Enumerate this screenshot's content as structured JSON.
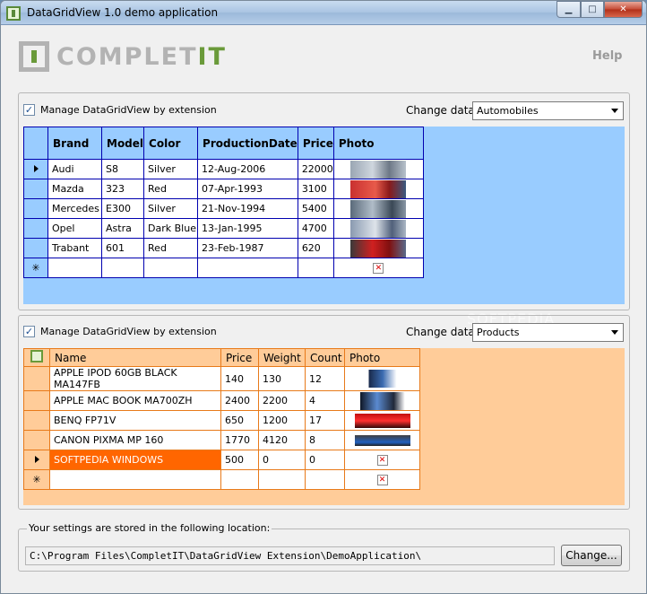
{
  "window": {
    "title": "DataGridView 1.0 demo application",
    "min_glyph": "▁",
    "max_glyph": "□",
    "close_glyph": "✕"
  },
  "header": {
    "logo_text_main": "COMPLET",
    "logo_text_accent": "IT",
    "help_label": "Help"
  },
  "grid1": {
    "checkbox_label": "Manage DataGridView by extension",
    "checkbox_glyph": "✓",
    "change_data_label": "Change data:",
    "combo_value": "Automobiles",
    "columns": [
      "Brand",
      "Model",
      "Color",
      "ProductionDate",
      "Price",
      "Photo"
    ],
    "rows": [
      {
        "brand": "Audi",
        "model": "S8",
        "color": "Silver",
        "date": "12-Aug-2006",
        "price": "22000"
      },
      {
        "brand": "Mazda",
        "model": "323",
        "color": "Red",
        "date": "07-Apr-1993",
        "price": "3100"
      },
      {
        "brand": "Mercedes",
        "model": "E300",
        "color": "Silver",
        "date": "21-Nov-1994",
        "price": "5400"
      },
      {
        "brand": "Opel",
        "model": "Astra",
        "color": "Dark Blue",
        "date": "13-Jan-1995",
        "price": "4700"
      },
      {
        "brand": "Trabant",
        "model": "601",
        "color": "Red",
        "date": "23-Feb-1987",
        "price": "620"
      }
    ],
    "new_row_glyph": "✳"
  },
  "grid2": {
    "checkbox_label": "Manage DataGridView by extension",
    "checkbox_glyph": "✓",
    "change_data_label": "Change data:",
    "combo_value": "Products",
    "columns": [
      "Name",
      "Price",
      "Weight",
      "Count",
      "Photo"
    ],
    "rows": [
      {
        "name": "APPLE IPOD 60GB BLACK MA147FB",
        "price": "140",
        "weight": "130",
        "count": "12"
      },
      {
        "name": "APPLE MAC BOOK MA700ZH",
        "price": "2400",
        "weight": "2200",
        "count": "4"
      },
      {
        "name": "BENQ FP71V",
        "price": "650",
        "weight": "1200",
        "count": "17"
      },
      {
        "name": "CANON PIXMA MP 160",
        "price": "1770",
        "weight": "4120",
        "count": "8"
      },
      {
        "name": "SOFTPEDIA WINDOWS",
        "price": "500",
        "weight": "0",
        "count": "0"
      }
    ],
    "new_row_glyph": "✳"
  },
  "settings": {
    "label": "Your settings are stored in the following location:",
    "path": "C:\\Program Files\\CompletIT\\DataGridView Extension\\DemoApplication\\",
    "change_button": "Change..."
  },
  "watermark": "SOFTPEDIA",
  "null_image_glyph": "✕"
}
